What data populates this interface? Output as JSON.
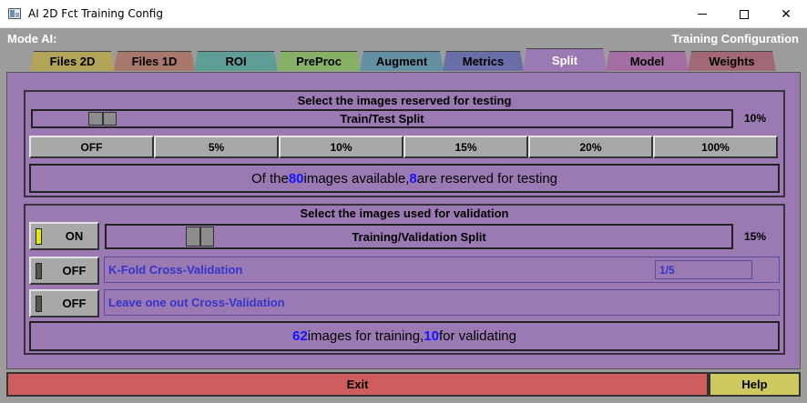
{
  "window": {
    "title": "AI 2D Fct Training Config",
    "minimize_glyph": "",
    "maximize_glyph": "",
    "close_glyph": "✕"
  },
  "header": {
    "mode": "Mode AI:",
    "section": "Training Configuration"
  },
  "tabs": [
    {
      "label": "Files 2D",
      "color": "#b2a458",
      "active": false
    },
    {
      "label": "Files 1D",
      "color": "#a8786c",
      "active": false
    },
    {
      "label": "ROI",
      "color": "#5e9e96",
      "active": false
    },
    {
      "label": "PreProc",
      "color": "#86b066",
      "active": false
    },
    {
      "label": "Augment",
      "color": "#6391a3",
      "active": false
    },
    {
      "label": "Metrics",
      "color": "#6a6ea8",
      "active": false
    },
    {
      "label": "Split",
      "color": "#9b7ab3",
      "active": true
    },
    {
      "label": "Model",
      "color": "#a56ea3",
      "active": false
    },
    {
      "label": "Weights",
      "color": "#a26878",
      "active": false
    }
  ],
  "testing": {
    "title": "Select the images reserved for testing",
    "slider_label": "Train/Test Split",
    "percent_text": "10%",
    "percent_value": 0.1,
    "presets": [
      "OFF",
      "5%",
      "10%",
      "15%",
      "20%",
      "100%"
    ],
    "info": {
      "pre": "Of the ",
      "total": "80",
      "mid": " images available, ",
      "reserved": "8",
      "post": " are reserved for testing"
    }
  },
  "validation": {
    "title": "Select the images used for validation",
    "toggle_label": "ON",
    "toggle_led_color": "#e8e800",
    "slider_label": "Training/Validation Split",
    "percent_text": "15%",
    "percent_value": 0.15,
    "kfold": {
      "toggle_label": "OFF",
      "label": "K-Fold Cross-Validation",
      "value": "1/5"
    },
    "loo": {
      "toggle_label": "OFF",
      "label": "Leave one out Cross-Validation"
    },
    "off_led_color": "#555555",
    "info": {
      "training": "62",
      "mid": " images for training, ",
      "validating": "10",
      "post": " for validating"
    }
  },
  "footer": {
    "exit_label": "Exit",
    "help_label": "Help"
  }
}
